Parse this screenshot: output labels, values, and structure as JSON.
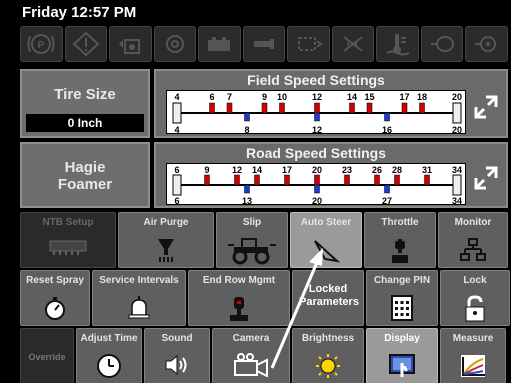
{
  "status": {
    "datetime": "Friday 12:57 PM"
  },
  "warnings": [
    {
      "icon": "parking-brake-icon"
    },
    {
      "icon": "warning-diamond-icon"
    },
    {
      "icon": "hydraulic-oil-icon"
    },
    {
      "icon": "alternator-icon"
    },
    {
      "icon": "battery-icon"
    },
    {
      "icon": "engine-icon"
    },
    {
      "icon": "coolant-icon"
    },
    {
      "icon": "air-filter-icon"
    },
    {
      "icon": "coolant-temp-icon"
    },
    {
      "icon": "fuel-filter-icon"
    },
    {
      "icon": "transmission-icon"
    }
  ],
  "tire": {
    "label": "Tire Size",
    "value": "0 Inch"
  },
  "product": {
    "label": "Hagie Foamer"
  },
  "field_speed": {
    "title": "Field Speed Settings",
    "top_ticks": [
      "4",
      "6",
      "7",
      "9",
      "10",
      "12",
      "14",
      "15",
      "17",
      "18",
      "20"
    ],
    "bottom_ticks": [
      "4",
      "8",
      "12",
      "16",
      "20"
    ]
  },
  "road_speed": {
    "title": "Road Speed Settings",
    "top_ticks": [
      "6",
      "9",
      "12",
      "14",
      "17",
      "20",
      "23",
      "26",
      "28",
      "31",
      "34"
    ],
    "bottom_ticks": [
      "6",
      "13",
      "20",
      "27",
      "34"
    ]
  },
  "buttons_row1": [
    {
      "label": "NTB Setup",
      "icon": "ntb-icon",
      "style": "dark"
    },
    {
      "label": "Air Purge",
      "icon": "air-purge-icon",
      "style": "normal"
    },
    {
      "label": "Slip",
      "icon": "slip-tractor-icon",
      "style": "normal"
    },
    {
      "label": "Auto Steer",
      "icon": "auto-steer-icon",
      "style": "light"
    },
    {
      "label": "Throttle",
      "icon": "throttle-icon",
      "style": "normal"
    },
    {
      "label": "Monitor",
      "icon": "network-icon",
      "style": "normal"
    }
  ],
  "buttons_row2": [
    {
      "label": "Reset Spray",
      "icon": "stopwatch-icon",
      "style": "normal"
    },
    {
      "label": "Service Intervals",
      "icon": "bell-icon",
      "style": "normal"
    },
    {
      "label": "End Row Mgmt",
      "icon": "joystick-icon",
      "style": "normal"
    },
    {
      "label": "Locked Parameters",
      "icon": "",
      "style": "normal"
    },
    {
      "label": "Change PIN",
      "icon": "keypad-icon",
      "style": "normal"
    },
    {
      "label": "Lock",
      "icon": "lock-icon",
      "style": "normal"
    }
  ],
  "buttons_row3": [
    {
      "label": "Override",
      "icon": "",
      "style": "dark"
    },
    {
      "label": "Adjust Time",
      "icon": "clock-icon",
      "style": "normal"
    },
    {
      "label": "Sound",
      "icon": "speaker-icon",
      "style": "normal"
    },
    {
      "label": "Camera",
      "icon": "camera-icon",
      "style": "normal"
    },
    {
      "label": "Brightness",
      "icon": "sun-icon",
      "style": "normal"
    },
    {
      "label": "Display",
      "icon": "display-touch-icon",
      "style": "light"
    },
    {
      "label": "Measure",
      "icon": "graph-icon",
      "style": "normal"
    }
  ]
}
